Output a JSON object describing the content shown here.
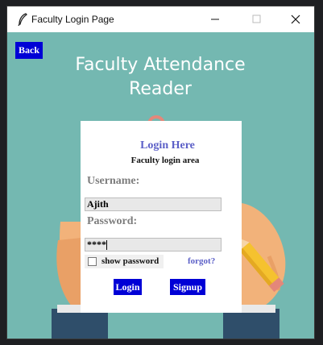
{
  "window": {
    "title": "Faculty Login Page"
  },
  "back_label": "Back",
  "heading": {
    "line1": "Faculty Attendance",
    "line2": "Reader"
  },
  "card": {
    "title": "Login Here",
    "subtitle": "Faculty login area",
    "username_label": "Username:",
    "username_value": "Ajith",
    "password_label": "Password:",
    "password_value": "****",
    "show_password_label": "show password",
    "forgot_label": "forgot?",
    "login_label": "Login",
    "signup_label": "Signup"
  },
  "colors": {
    "background": "#74b8b1",
    "button": "#0000d6",
    "accent_text": "#5b5fc7"
  }
}
